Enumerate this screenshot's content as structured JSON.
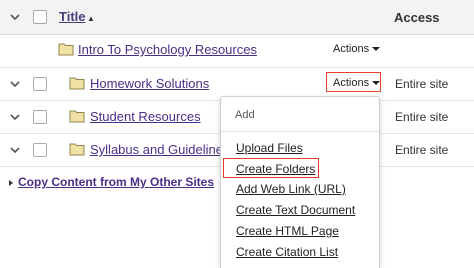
{
  "table": {
    "header": {
      "title": "Title",
      "sort_indicator": "▲",
      "access": "Access"
    },
    "rows": [
      {
        "title": "Intro To Psychology Resources",
        "actions": "Actions",
        "access": ""
      },
      {
        "title": "Homework Solutions",
        "actions": "Actions",
        "access": "Entire site"
      },
      {
        "title": "Student Resources",
        "actions": "",
        "access": "Entire site"
      },
      {
        "title": "Syllabus and Guidelines",
        "actions": "",
        "access": "Entire site"
      }
    ]
  },
  "copy_content": {
    "label": "Copy Content from My Other Sites"
  },
  "actions_menu": {
    "section_label": "Add",
    "items": [
      "Upload Files",
      "Create Folders",
      "Add Web Link (URL)",
      "Create Text Document",
      "Create HTML Page",
      "Create Citation List"
    ]
  },
  "colors": {
    "link": "#4a2f86",
    "highlight": "#e0402c",
    "header_bg": "#f3f3f3"
  }
}
